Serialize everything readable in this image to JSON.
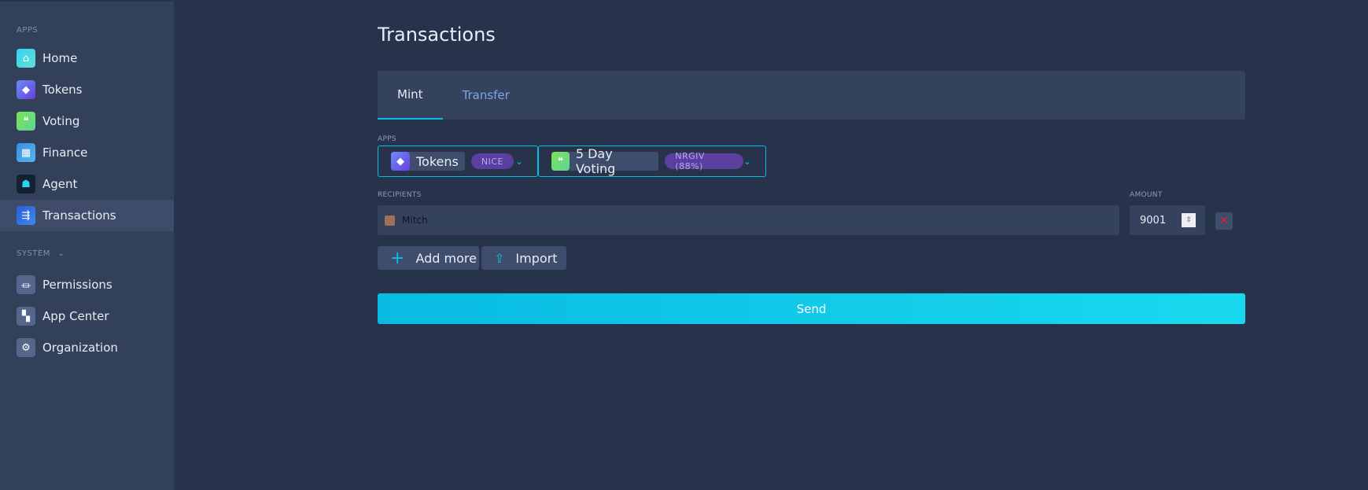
{
  "sidebar": {
    "apps_label": "APPS",
    "items": [
      {
        "label": "Home",
        "icon": "home-icon"
      },
      {
        "label": "Tokens",
        "icon": "tokens-icon"
      },
      {
        "label": "Voting",
        "icon": "voting-icon"
      },
      {
        "label": "Finance",
        "icon": "finance-icon"
      },
      {
        "label": "Agent",
        "icon": "agent-icon"
      },
      {
        "label": "Transactions",
        "icon": "transactions-icon"
      }
    ],
    "system_label": "SYSTEM",
    "system_items": [
      {
        "label": "Permissions",
        "icon": "permissions-icon"
      },
      {
        "label": "App Center",
        "icon": "app-center-icon"
      },
      {
        "label": "Organization",
        "icon": "organization-icon"
      }
    ]
  },
  "main": {
    "title": "Transactions",
    "tabs": [
      {
        "label": "Mint"
      },
      {
        "label": "Transfer"
      }
    ],
    "apps_label": "APPS",
    "app_select": {
      "name": "Tokens",
      "badge": "NICE"
    },
    "voting_select": {
      "name": "5 Day Voting",
      "badge": "NRGIV (88%)"
    },
    "recipients_label": "RECIPIENTS",
    "recipient": "Mitch",
    "amount_label": "AMOUNT",
    "amount": "9001",
    "add_more": "Add more",
    "import": "Import",
    "send": "Send"
  },
  "colors": {
    "accent": "#08bee5",
    "badge": "#5b3e9e",
    "remove": "#e0202a"
  }
}
